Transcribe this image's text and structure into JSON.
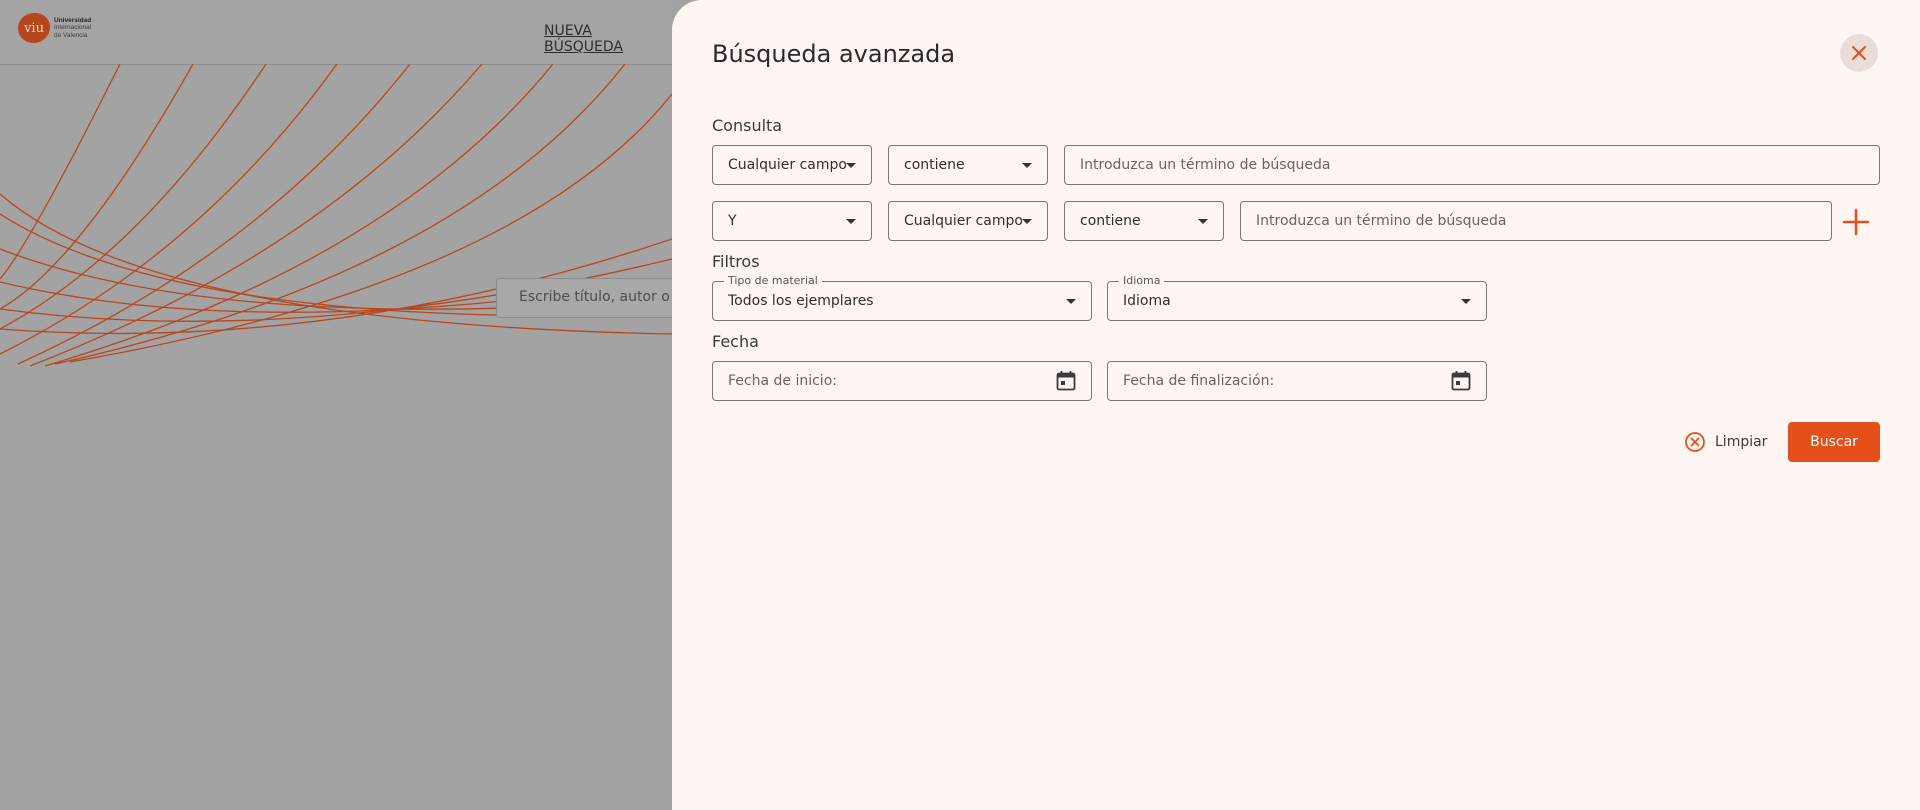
{
  "background": {
    "logo": {
      "mark": "viu",
      "line1": "Universidad",
      "line2": "Internacional",
      "line3": "de Valencia"
    },
    "nav_new_search": "NUEVA BÚSQUEDA",
    "search_placeholder": "Escribe título, autor o t"
  },
  "drawer": {
    "title": "Búsqueda avanzada",
    "close_icon": "close-icon",
    "query": {
      "label": "Consulta",
      "rows": [
        {
          "field": "Cualquier campo",
          "condition": "contiene",
          "placeholder": "Introduzca un término de búsqueda"
        },
        {
          "operator": "Y",
          "field": "Cualquier campo",
          "condition": "contiene",
          "placeholder": "Introduzca un término de búsqueda"
        }
      ],
      "add_icon": "plus-icon"
    },
    "filters": {
      "label": "Filtros",
      "material": {
        "label": "Tipo de material",
        "value": "Todos los ejemplares"
      },
      "language": {
        "label": "Idioma",
        "value": "Idioma"
      }
    },
    "date": {
      "label": "Fecha",
      "start_placeholder": "Fecha de inicio:",
      "end_placeholder": "Fecha de finalización:",
      "calendar_icon": "calendar-icon"
    },
    "actions": {
      "clear": "Limpiar",
      "search": "Buscar"
    }
  },
  "colors": {
    "accent": "#e5501a",
    "drawer_bg": "#fff6f4",
    "overlay": "#a3a3a3"
  }
}
